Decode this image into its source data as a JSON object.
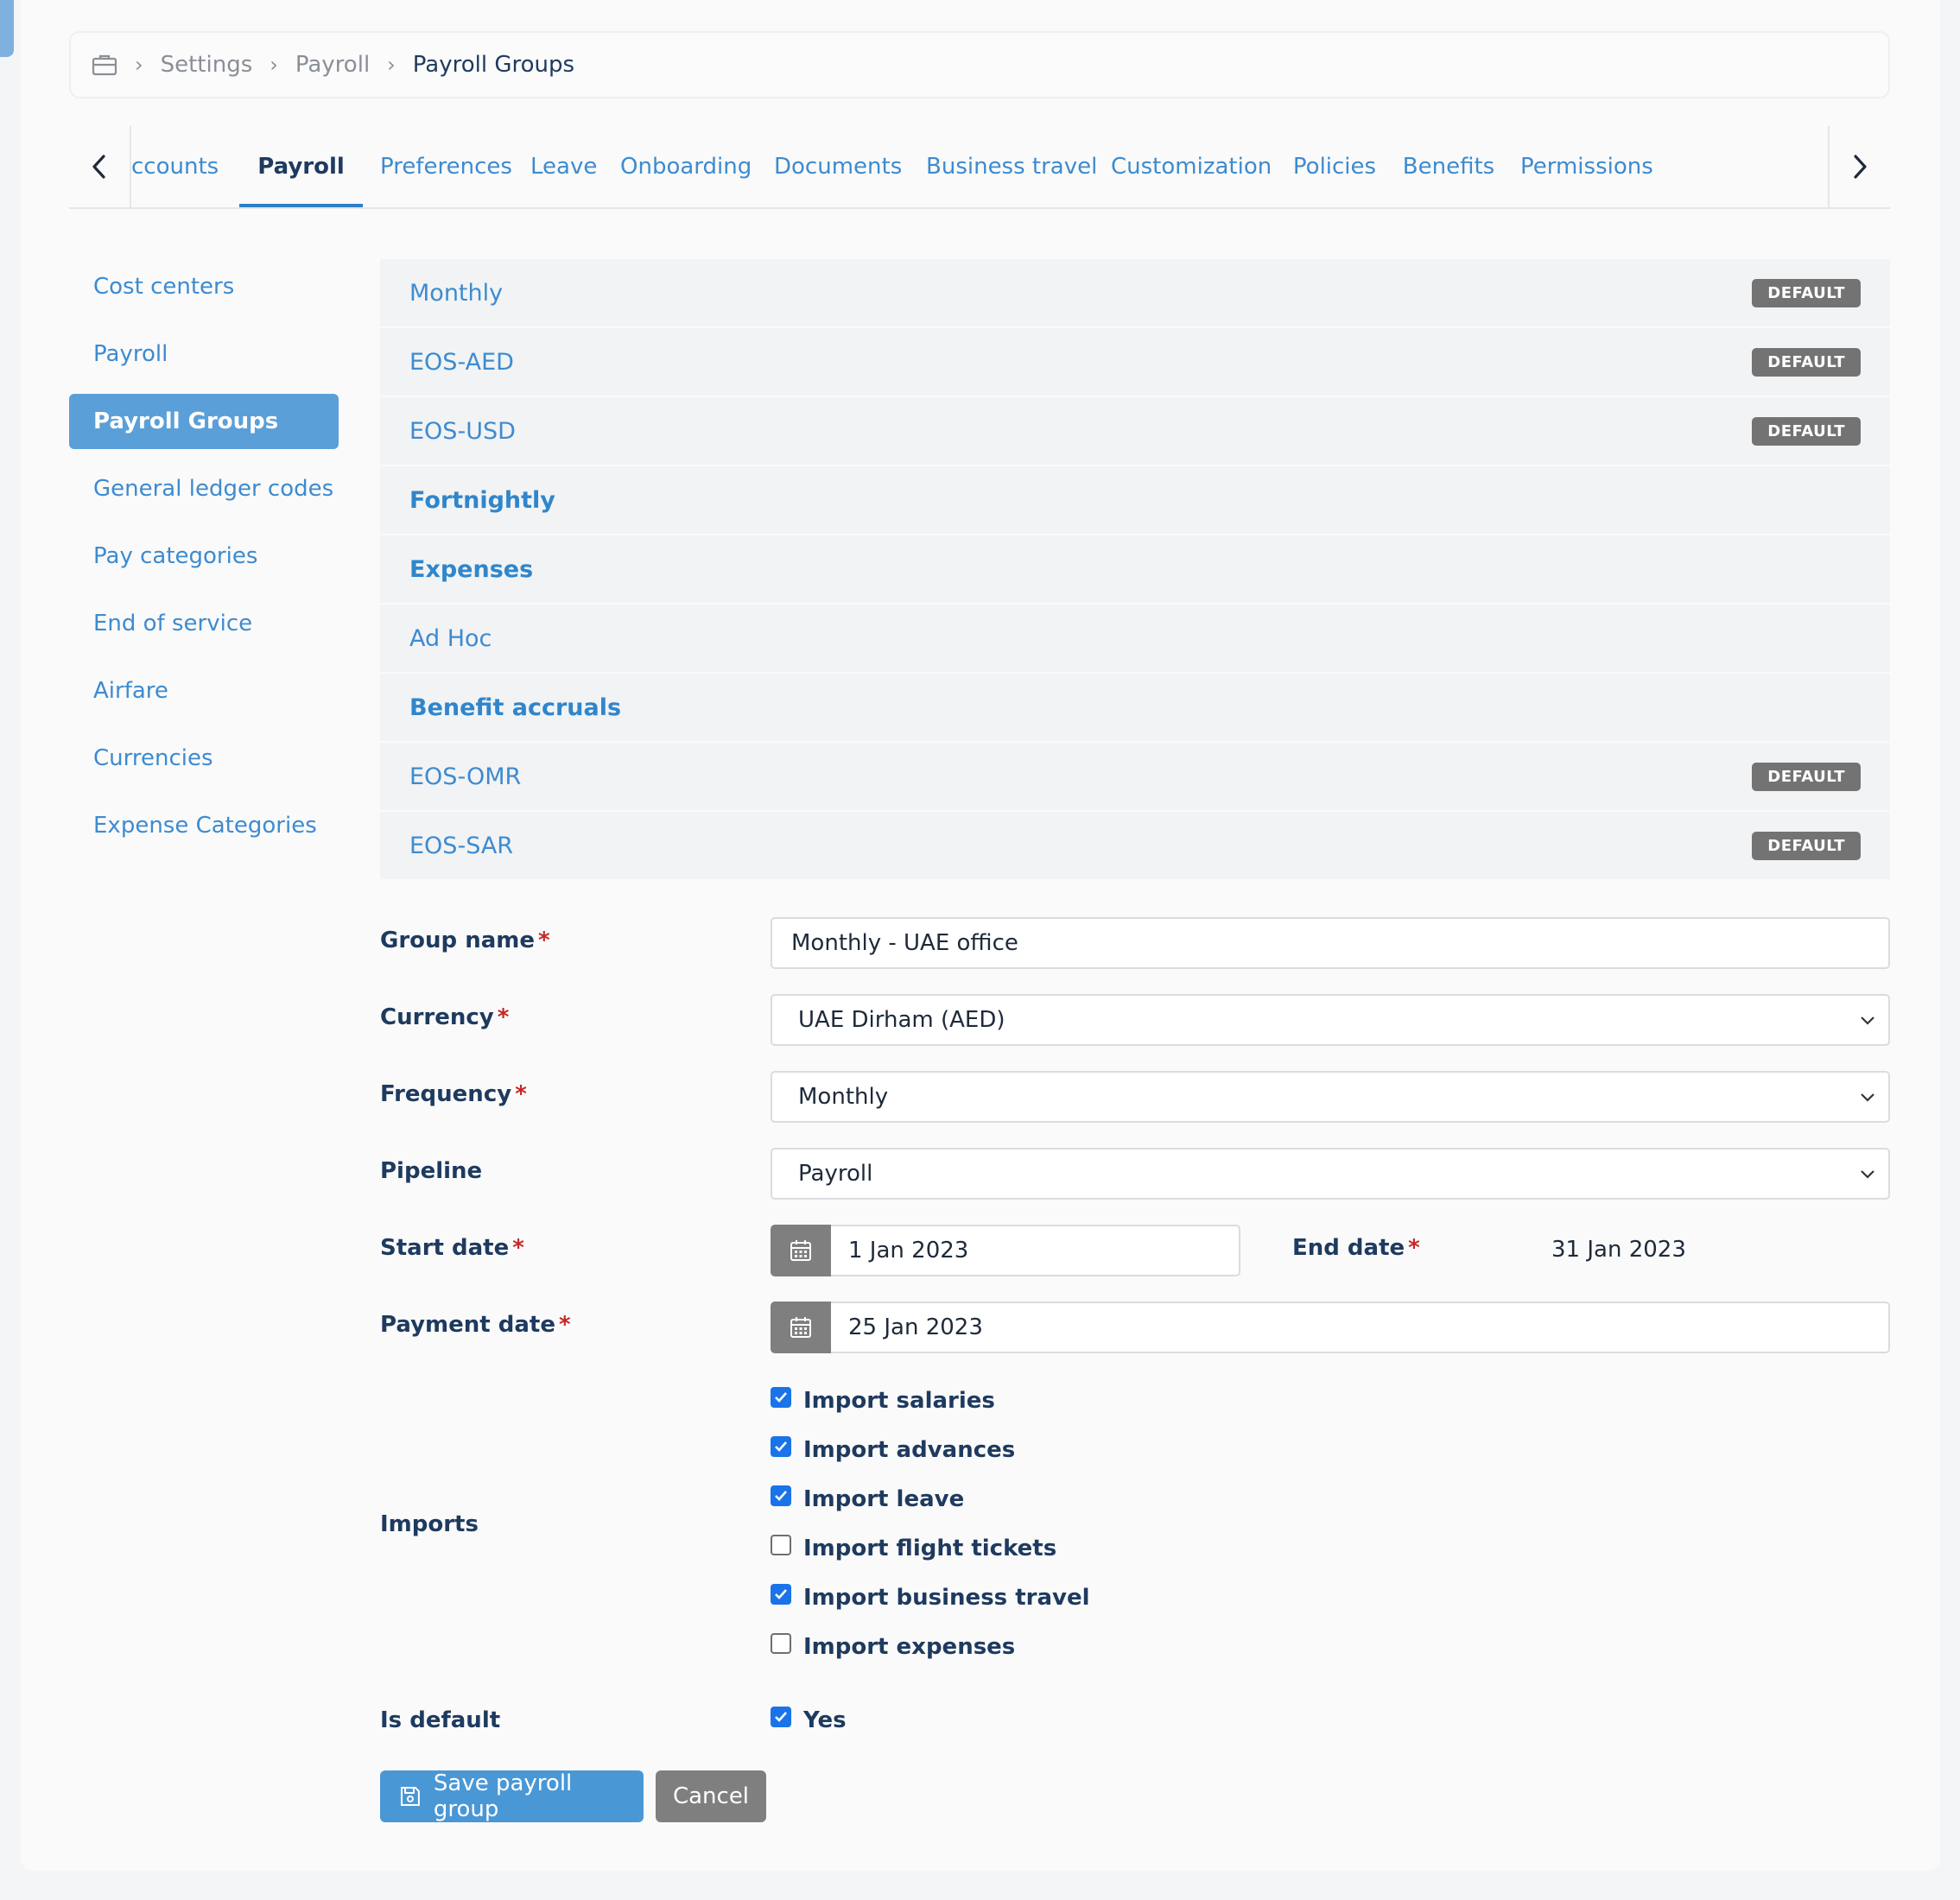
{
  "breadcrumb": {
    "items": [
      "Settings",
      "Payroll",
      "Payroll Groups"
    ]
  },
  "tabs": [
    {
      "label": "ccounts"
    },
    {
      "label": "Payroll",
      "active": true
    },
    {
      "label": "Preferences"
    },
    {
      "label": "Leave"
    },
    {
      "label": "Onboarding"
    },
    {
      "label": "Documents"
    },
    {
      "label": "Business travel"
    },
    {
      "label": "Customization"
    },
    {
      "label": "Policies"
    },
    {
      "label": "Benefits"
    },
    {
      "label": "Permissions"
    }
  ],
  "sidenav": {
    "items": [
      {
        "label": "Cost centers"
      },
      {
        "label": "Payroll"
      },
      {
        "label": "Payroll Groups",
        "active": true
      },
      {
        "label": "General ledger codes"
      },
      {
        "label": "Pay categories"
      },
      {
        "label": "End of service"
      },
      {
        "label": "Airfare"
      },
      {
        "label": "Currencies"
      },
      {
        "label": "Expense Categories"
      }
    ]
  },
  "groups": [
    {
      "name": "Monthly",
      "badge": "DEFAULT"
    },
    {
      "name": "EOS-AED",
      "badge": "DEFAULT"
    },
    {
      "name": "EOS-USD",
      "badge": "DEFAULT"
    },
    {
      "name": "Fortnightly",
      "badge": ""
    },
    {
      "name": "Expenses",
      "badge": ""
    },
    {
      "name": "Ad Hoc",
      "badge": ""
    },
    {
      "name": "Benefit accruals",
      "badge": ""
    },
    {
      "name": "EOS-OMR",
      "badge": "DEFAULT"
    },
    {
      "name": "EOS-SAR",
      "badge": "DEFAULT"
    }
  ],
  "form": {
    "group_name": {
      "label": "Group name",
      "value": "Monthly - UAE office"
    },
    "currency": {
      "label": "Currency",
      "value": "UAE Dirham (AED)"
    },
    "frequency": {
      "label": "Frequency",
      "value": "Monthly"
    },
    "pipeline": {
      "label": "Pipeline",
      "value": "Payroll"
    },
    "start_date": {
      "label": "Start date",
      "value": "1 Jan 2023"
    },
    "end_date": {
      "label": "End date",
      "value": "31 Jan 2023"
    },
    "payment_date": {
      "label": "Payment date",
      "value": "25 Jan 2023"
    },
    "imports": {
      "label": "Imports",
      "options": [
        {
          "label": "Import salaries",
          "checked": true
        },
        {
          "label": "Import advances",
          "checked": true
        },
        {
          "label": "Import leave",
          "checked": true
        },
        {
          "label": "Import flight tickets",
          "checked": false
        },
        {
          "label": "Import business travel",
          "checked": true
        },
        {
          "label": "Import expenses",
          "checked": false
        }
      ]
    },
    "is_default": {
      "label": "Is default",
      "option": "Yes",
      "checked": true
    },
    "required_mark": "*"
  },
  "buttons": {
    "save": "Save payroll group",
    "cancel": "Cancel"
  },
  "colors": {
    "accent": "#4a97d6",
    "link": "#3d8bd0",
    "badge": "#737373",
    "required": "#c62828"
  }
}
